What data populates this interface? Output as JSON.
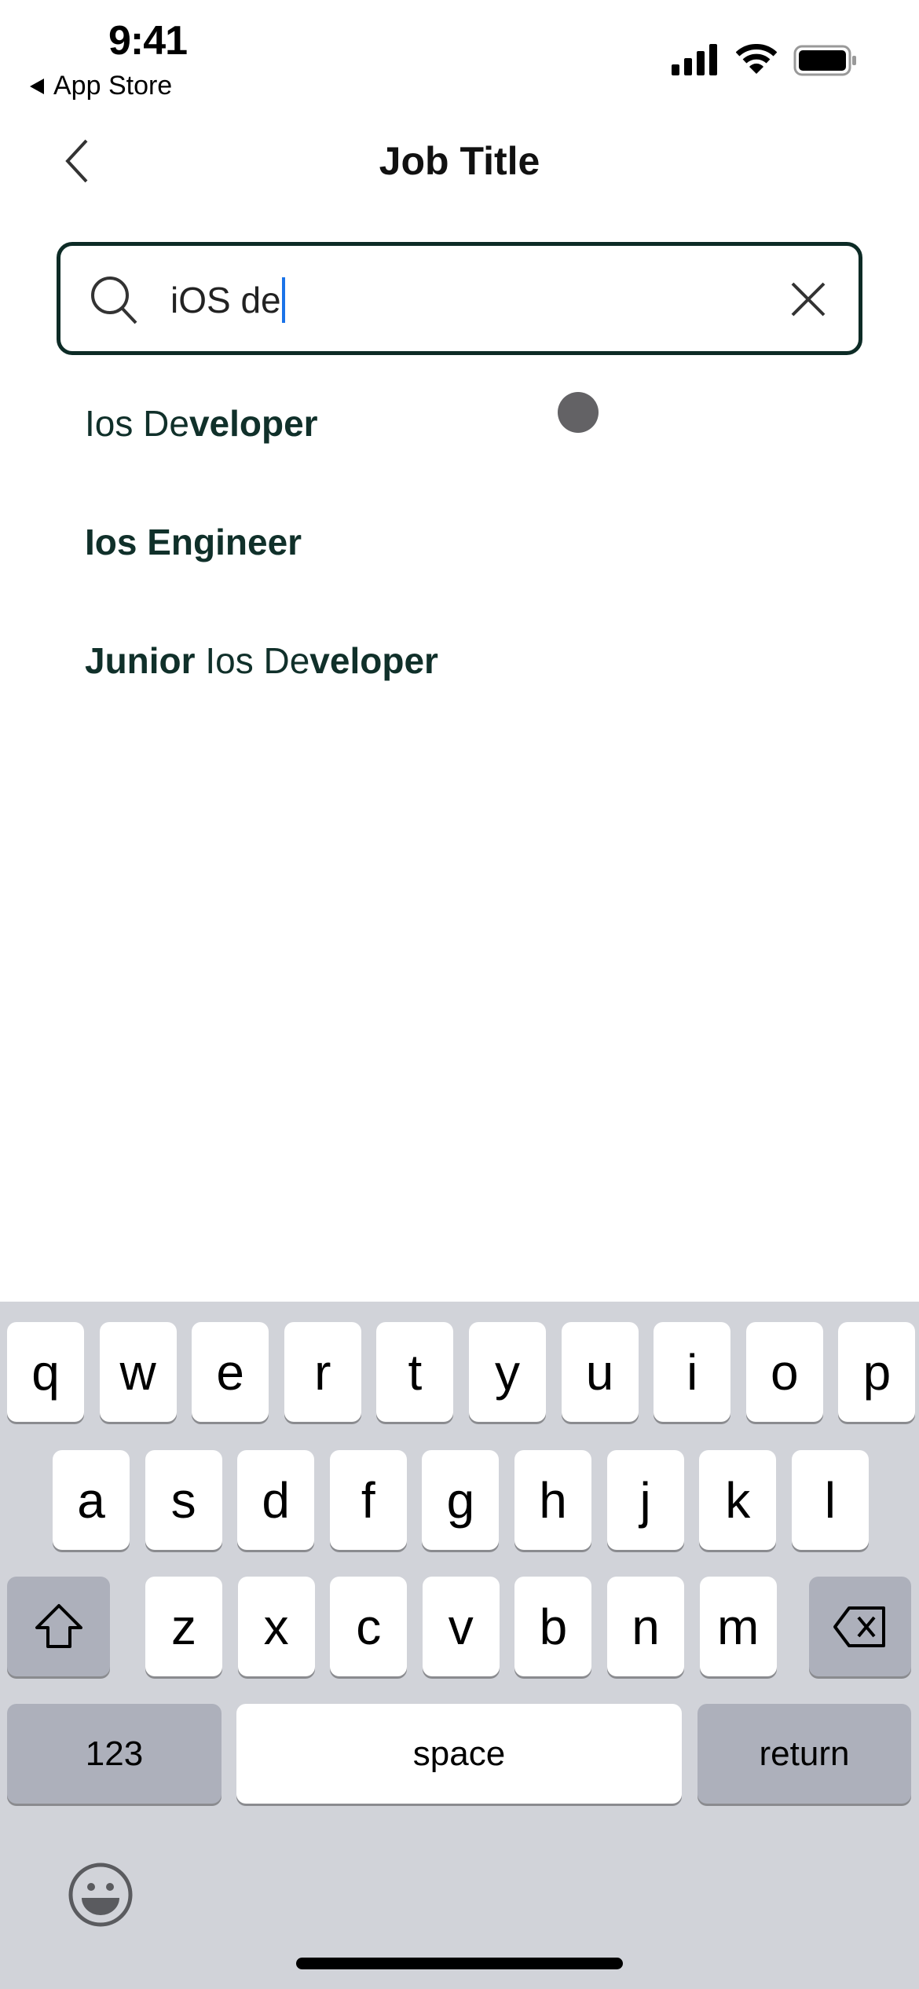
{
  "status_bar": {
    "time": "9:41",
    "back_app": "App Store",
    "icons": [
      "signal-icon",
      "wifi-icon",
      "battery-icon"
    ]
  },
  "nav": {
    "title": "Job Title",
    "back_icon": "chevron-left-icon"
  },
  "search": {
    "value": "iOS de",
    "search_icon": "search-icon",
    "clear_icon": "close-icon",
    "border_color": "#0d2b26",
    "caret_color": "#1a73e8"
  },
  "results": [
    {
      "parts": [
        {
          "text": "Ios De",
          "bold": false
        },
        {
          "text": "veloper",
          "bold": true
        }
      ]
    },
    {
      "parts": [
        {
          "text": "Ios Engineer",
          "bold": true
        }
      ]
    },
    {
      "parts": [
        {
          "text": "Junior",
          "bold": true
        },
        {
          "text": " Ios De",
          "bold": false
        },
        {
          "text": "veloper",
          "bold": true
        }
      ]
    }
  ],
  "keyboard": {
    "row1": [
      "q",
      "w",
      "e",
      "r",
      "t",
      "y",
      "u",
      "i",
      "o",
      "p"
    ],
    "row2": [
      "a",
      "s",
      "d",
      "f",
      "g",
      "h",
      "j",
      "k",
      "l"
    ],
    "row3": [
      "z",
      "x",
      "c",
      "v",
      "b",
      "n",
      "m"
    ],
    "numbers": "123",
    "space": "space",
    "return": "return",
    "shift_icon": "shift-icon",
    "delete_icon": "delete-icon",
    "emoji_icon": "emoji-icon"
  }
}
